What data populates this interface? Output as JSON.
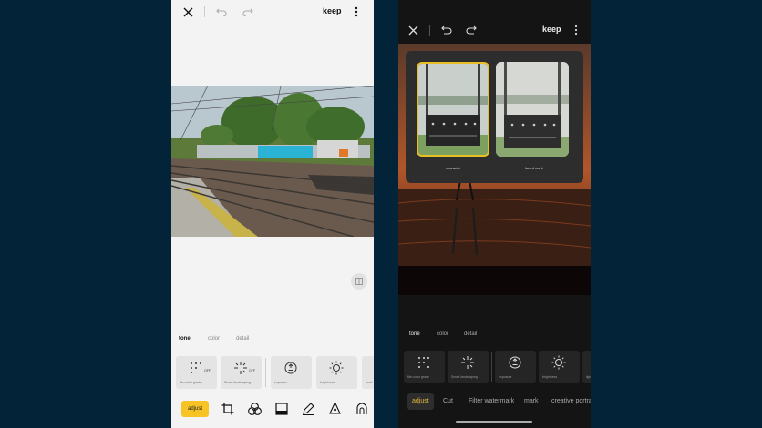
{
  "left_phone": {
    "header": {
      "keep_label": "keep"
    },
    "tabs": [
      "tone",
      "color",
      "detail"
    ],
    "tools": [
      {
        "label": "film color grade-",
        "badge": "OFF"
      },
      {
        "label": "Smart landscaping",
        "badge": "OFF"
      },
      {
        "label": "exposure"
      },
      {
        "label": "brightness"
      },
      {
        "label": "contr"
      }
    ],
    "bottom_nav": {
      "adjust_label": "adjust"
    },
    "colors": {
      "accent": "#f7c325",
      "background": "#f3f3f3"
    }
  },
  "right_phone": {
    "header": {
      "keep_label": "keep"
    },
    "style_popup": {
      "options": [
        {
          "label": "character",
          "selected": true
        },
        {
          "label": "faded contr"
        }
      ]
    },
    "tabs": [
      "tone",
      "color",
      "detail"
    ],
    "tools": [
      {
        "label": "film color grade"
      },
      {
        "label": "Smart landscaping"
      },
      {
        "label": "exposure"
      },
      {
        "label": "brightness"
      },
      {
        "label": "light"
      }
    ],
    "bottom_menu": [
      "adjust",
      "Cut",
      "Filter watermark",
      "mark",
      "creative portrait"
    ],
    "colors": {
      "accent": "#e2b53a",
      "selection": "#e8c024",
      "background": "#141414"
    }
  },
  "colors": {
    "page_background": "#032338"
  }
}
